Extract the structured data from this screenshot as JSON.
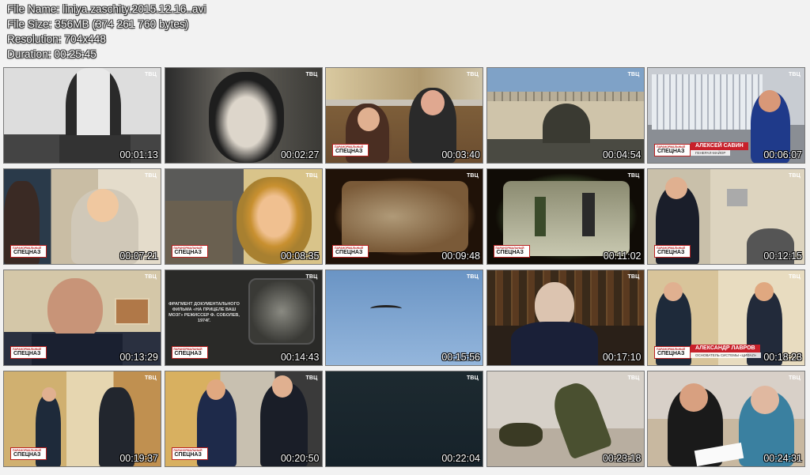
{
  "header": {
    "file_name": "File Name: liniya.zaschity.2015.12.16..avi",
    "file_size": "File Size: 356MB (374 261 760 bytes)",
    "resolution": "Resolution: 704x448",
    "duration": "Duration: 00:25:45"
  },
  "channel_logo": "ТВЦ",
  "show_logo": {
    "line1": "ПАРАНОРМАЛЬНЫЙ",
    "line2": "СПЕЦНАЗ"
  },
  "thumbnails": [
    {
      "time": "00:01:13",
      "scene": "bw-portrait"
    },
    {
      "time": "00:02:27",
      "scene": "bw-woman"
    },
    {
      "time": "00:03:40",
      "scene": "street-couple"
    },
    {
      "time": "00:04:54",
      "scene": "building-arch"
    },
    {
      "time": "00:06:07",
      "scene": "interview-street",
      "caption": "АЛЕКСЕЙ САВИН",
      "caption_sub": "ГЕНЕРАЛ-МАЙОР"
    },
    {
      "time": "00:07:21",
      "scene": "office-women"
    },
    {
      "time": "00:08:35",
      "scene": "war-woman"
    },
    {
      "time": "00:09:48",
      "scene": "old-film"
    },
    {
      "time": "00:11:02",
      "scene": "training-old"
    },
    {
      "time": "00:12:15",
      "scene": "room-men"
    },
    {
      "time": "00:13:29",
      "scene": "bald-man"
    },
    {
      "time": "00:14:43",
      "scene": "doc-fragment",
      "doc_text": "ФРАГМЕНТ ДОКУМЕНТАЛЬНОГО ФИЛЬМА «НА ПРИЦЕЛЕ ВАШ МОЗГ» РЕЖИССЕР Ф. СОБОЛЕВ, 1974Г."
    },
    {
      "time": "00:15:56",
      "scene": "sky-bird"
    },
    {
      "time": "00:17:10",
      "scene": "library-man"
    },
    {
      "time": "00:18:23",
      "scene": "men-room",
      "caption": "АЛЕКСАНДР ЛАВРОВ",
      "caption_sub": "ОСНОВАТЕЛЬ СИСТЕМЫ «ЦИФАЛ»"
    },
    {
      "time": "00:19:37",
      "scene": "hall-men"
    },
    {
      "time": "00:20:50",
      "scene": "fight-men"
    },
    {
      "time": "00:22:04",
      "scene": "dark"
    },
    {
      "time": "00:23:18",
      "scene": "soldiers"
    },
    {
      "time": "00:24:31",
      "scene": "cafe-couple"
    }
  ]
}
